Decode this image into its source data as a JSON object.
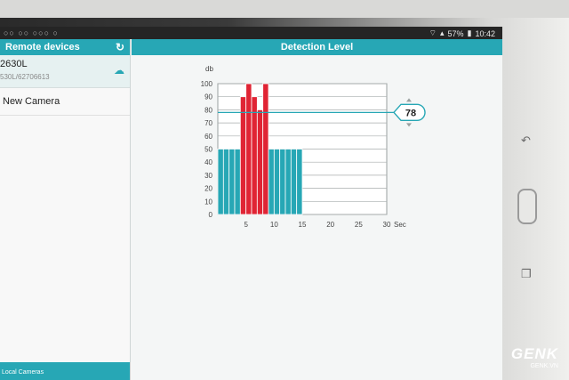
{
  "status_bar": {
    "left_icons": "○○ ○○ ○○○ ○",
    "battery_percent": "57%",
    "time": "10:42"
  },
  "sidebar": {
    "title": "Remote devices",
    "devices": [
      {
        "name": "2630L",
        "sub": "530L/62706613"
      },
      {
        "name": "New Camera"
      }
    ],
    "footer": "Local Cameras"
  },
  "main": {
    "title": "Detection Level"
  },
  "chart_data": {
    "type": "bar",
    "ylabel": "db",
    "xlabel": "Sec",
    "xlim": [
      0,
      30
    ],
    "ylim": [
      0,
      100
    ],
    "x_ticks": [
      5,
      10,
      15,
      20,
      25,
      30
    ],
    "y_ticks": [
      0,
      10,
      20,
      30,
      40,
      50,
      60,
      70,
      80,
      90,
      100
    ],
    "threshold": 78,
    "threshold_label": "78",
    "grid": true,
    "colors": {
      "below": "#27a7b5",
      "above": "#e02434",
      "threshold": "#27a7b5"
    },
    "bars": [
      {
        "x": 0.5,
        "value": 50
      },
      {
        "x": 1.5,
        "value": 50
      },
      {
        "x": 2.5,
        "value": 50
      },
      {
        "x": 3.5,
        "value": 50
      },
      {
        "x": 4.5,
        "value": 90
      },
      {
        "x": 5.5,
        "value": 100
      },
      {
        "x": 6.5,
        "value": 90
      },
      {
        "x": 7.5,
        "value": 80
      },
      {
        "x": 8.5,
        "value": 100
      },
      {
        "x": 9.5,
        "value": 50
      },
      {
        "x": 10.5,
        "value": 50
      },
      {
        "x": 11.5,
        "value": 50
      },
      {
        "x": 12.5,
        "value": 50
      },
      {
        "x": 13.5,
        "value": 50
      },
      {
        "x": 14.5,
        "value": 50
      }
    ]
  },
  "watermark": {
    "brand": "GENK",
    "url": "GENK.VN"
  }
}
